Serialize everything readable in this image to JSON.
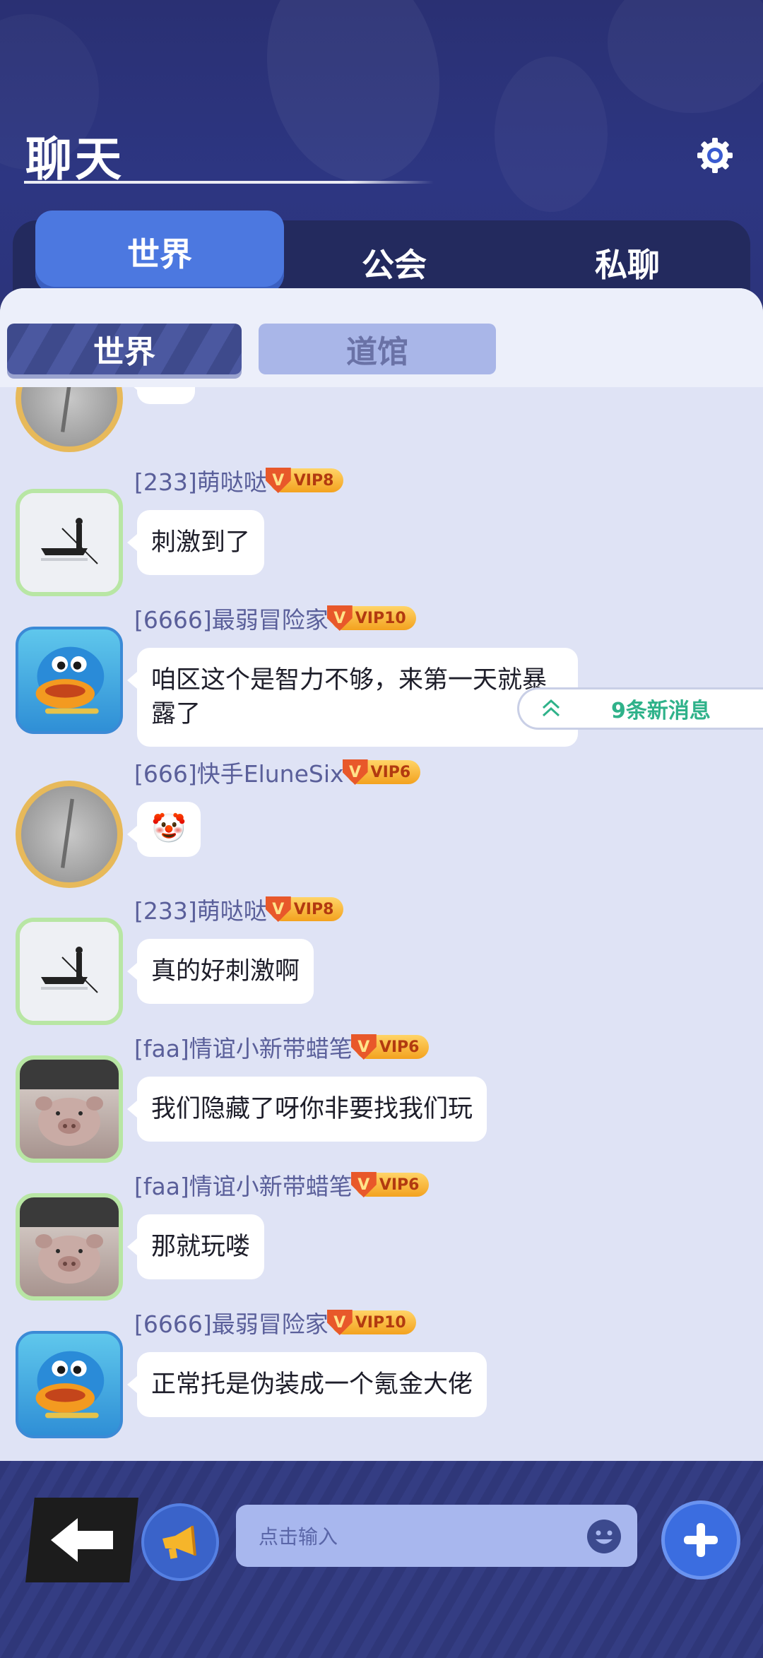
{
  "header": {
    "title": "聊天",
    "settings_icon": "gear-icon"
  },
  "tabs": [
    {
      "label": "世界",
      "active": true
    },
    {
      "label": "公会",
      "active": false
    },
    {
      "label": "私聊",
      "active": false
    }
  ],
  "subtabs": [
    {
      "label": "世界",
      "active": true
    },
    {
      "label": "道馆",
      "active": false
    }
  ],
  "new_messages": {
    "label": "9条新消息"
  },
  "messages": [
    {
      "avatar": "frame-avatar",
      "name": "",
      "vip": "",
      "text": "😊"
    },
    {
      "avatar": "boat-avatar",
      "name": "[233]萌哒哒",
      "vip": "VIP8",
      "text": "刺激到了"
    },
    {
      "avatar": "duck-avatar",
      "name": "[6666]最弱冒险家",
      "vip": "VIP10",
      "text": "咱区这个是智力不够，来第一天就暴露了"
    },
    {
      "avatar": "frame-avatar",
      "name": "[666]快手EluneSix",
      "vip": "VIP6",
      "text": "🤡"
    },
    {
      "avatar": "boat-avatar",
      "name": "[233]萌哒哒",
      "vip": "VIP8",
      "text": "真的好刺激啊"
    },
    {
      "avatar": "pig-avatar",
      "name": "[faa]情谊小新带蜡笔",
      "vip": "VIP6",
      "text": "我们隐藏了呀你非要找我们玩"
    },
    {
      "avatar": "pig-avatar",
      "name": "[faa]情谊小新带蜡笔",
      "vip": "VIP6",
      "text": "那就玩喽"
    },
    {
      "avatar": "duck-avatar",
      "name": "[6666]最弱冒险家",
      "vip": "VIP10",
      "text": "正常托是伪装成一个氪金大佬"
    }
  ],
  "input": {
    "placeholder": "点击输入"
  },
  "colors": {
    "accent": "#4c78e0",
    "panel": "#dfe3f5",
    "new_message_text": "#2fb28a",
    "vip_gold": "#f3a21f"
  }
}
